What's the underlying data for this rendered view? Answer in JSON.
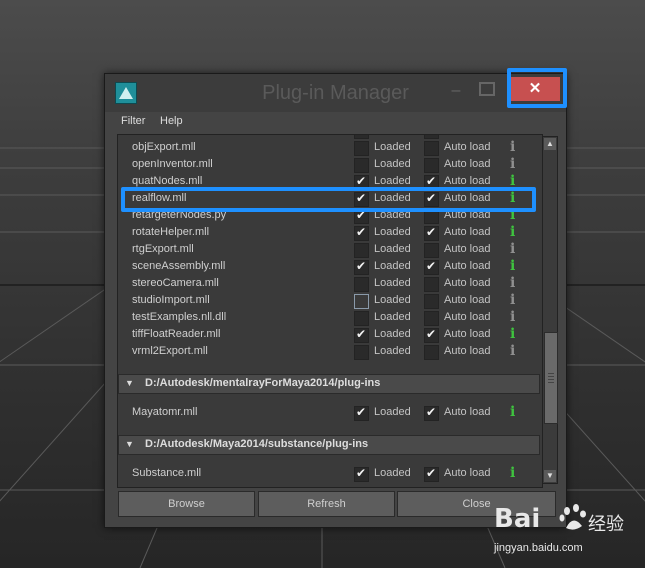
{
  "window": {
    "title": "Plug-in Manager",
    "close_glyph": "✕"
  },
  "menubar": {
    "items": [
      "Filter",
      "Help"
    ]
  },
  "columns": {
    "loaded": "Loaded",
    "autoload": "Auto load",
    "info": "i"
  },
  "plugins": [
    {
      "name": "objExport.mll",
      "loaded": false,
      "autoload": false,
      "active": false
    },
    {
      "name": "openInventor.mll",
      "loaded": false,
      "autoload": false,
      "active": false
    },
    {
      "name": "quatNodes.mll",
      "loaded": true,
      "autoload": true,
      "active": true
    },
    {
      "name": "realflow.mll",
      "loaded": true,
      "autoload": true,
      "active": true
    },
    {
      "name": "retargeterNodes.py",
      "loaded": true,
      "autoload": false,
      "active": true
    },
    {
      "name": "rotateHelper.mll",
      "loaded": true,
      "autoload": true,
      "active": true
    },
    {
      "name": "rtgExport.mll",
      "loaded": false,
      "autoload": false,
      "active": false
    },
    {
      "name": "sceneAssembly.mll",
      "loaded": true,
      "autoload": true,
      "active": true
    },
    {
      "name": "stereoCamera.mll",
      "loaded": false,
      "autoload": false,
      "active": false
    },
    {
      "name": "studioImport.mll",
      "loaded": false,
      "autoload": false,
      "active": false
    },
    {
      "name": "testExamples.nll.dll",
      "loaded": false,
      "autoload": false,
      "active": false
    },
    {
      "name": "tiffFloatReader.mll",
      "loaded": true,
      "autoload": true,
      "active": true
    },
    {
      "name": "vrml2Export.mll",
      "loaded": false,
      "autoload": false,
      "active": false
    }
  ],
  "sections": [
    {
      "title": "D:/Autodesk/mentalrayForMaya2014/plug-ins",
      "plugins": [
        {
          "name": "Mayatomr.mll",
          "loaded": true,
          "autoload": true,
          "active": true
        }
      ]
    },
    {
      "title": "D:/Autodesk/Maya2014/substance/plug-ins",
      "plugins": [
        {
          "name": "Substance.mll",
          "loaded": true,
          "autoload": true,
          "active": true
        }
      ]
    }
  ],
  "buttons": {
    "browse": "Browse",
    "refresh": "Refresh",
    "close": "Close"
  },
  "watermark": {
    "logo": "Bai",
    "logo2": "du",
    "cn": "经验",
    "url": "jingyan.baidu.com"
  },
  "colors": {
    "highlight": "#1e90ff",
    "close_button": "#c75050",
    "info_active": "#3fc33f"
  },
  "icons": {
    "app": "maya-icon",
    "scroll_up": "arrow-up-icon",
    "scroll_down": "arrow-down-icon",
    "section": "triangle-down-icon"
  }
}
